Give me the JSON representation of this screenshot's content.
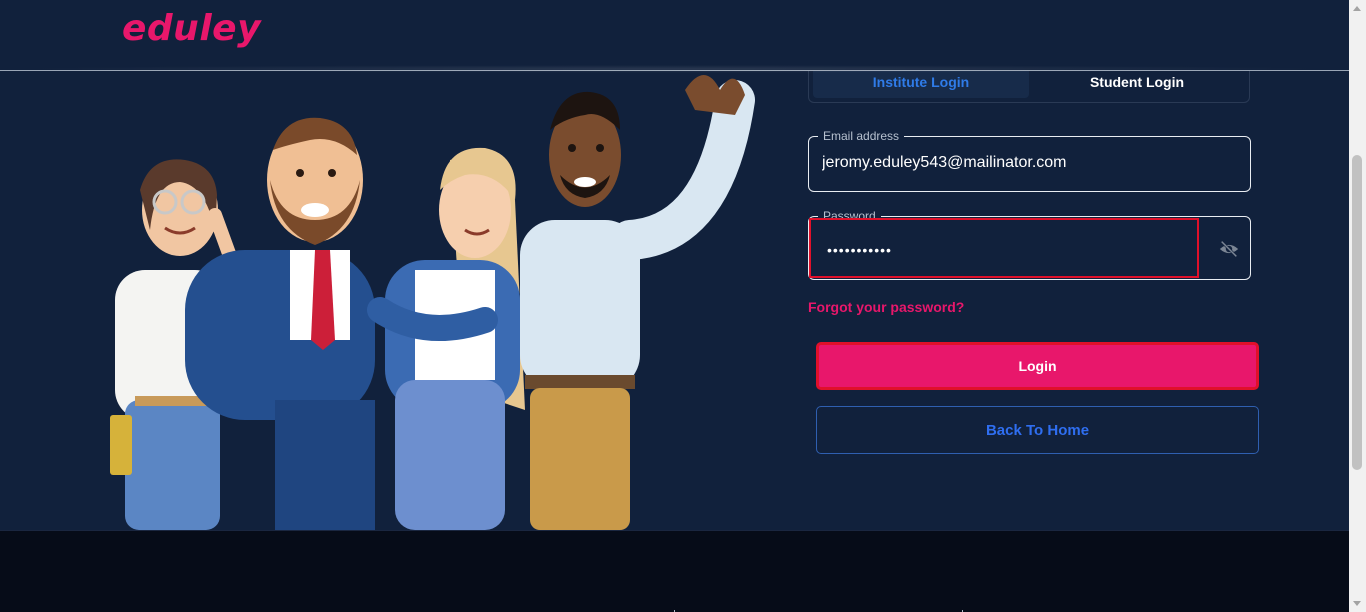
{
  "header": {
    "logo_text": "eduley",
    "brand_color": "#e8176b"
  },
  "login": {
    "tabs": [
      {
        "label": "Institute Login",
        "active": true
      },
      {
        "label": "Student Login",
        "active": false
      }
    ],
    "email": {
      "label": "Email address",
      "value": "jeromy.eduley543@mailinator.com"
    },
    "password": {
      "label": "Password",
      "masked_value": "•••••••••••",
      "toggle_icon": "eye-off-icon"
    },
    "forgot_link": "Forgot your password?",
    "login_button": "Login",
    "back_button": "Back To Home"
  },
  "colors": {
    "background": "#11213c",
    "accent_pink": "#e8176b",
    "accent_blue": "#2f6ef0",
    "focus_red": "#e0102a",
    "footer": "#060c18"
  }
}
